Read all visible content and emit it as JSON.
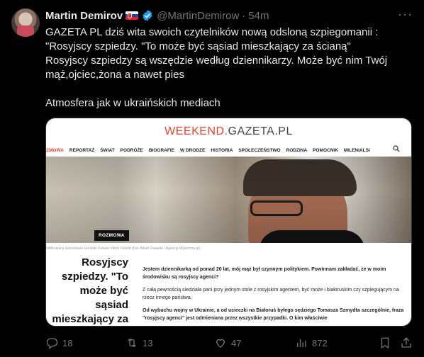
{
  "tweet": {
    "author_name": "Martin Demirov",
    "handle": "@MartinDemirow",
    "separator": "·",
    "time": "54m",
    "more_icon": "more-horizontal-icon",
    "text_lines": [
      "GAZETA PL dziś wita swoich czytelników nową odsloną szpiegomanii :",
      "\"Rosyjscy szpiedzy. \"To może być sąsiad mieszkający za ścianą\"",
      "Rosyjscy szpiedzy są wszędzie według dziennikarzy. Może być nim Twój",
      "mąż,ojciec,żona a nawet pies"
    ],
    "text_after_gap": "Atmosfera jak w ukraińskich mediach"
  },
  "card": {
    "logo_accent": "WEEKEND.",
    "logo_rest": "GAZETA.PL",
    "menu": [
      "ZMOWA",
      "REPORTAŻ",
      "ŚWIAT",
      "PODRÓŻE",
      "BIOGRAFIE",
      "W DRODZE",
      "HISTORIA",
      "SPOŁECZEŃSTWO",
      "RODZINA",
      "POMOCNIK",
      "MILENIALSI"
    ],
    "badge": "ROZMOWA",
    "caption": "Infiltrowany dziennikarz Gerardo Donato Viktor Girardi (Fot. Albert Zawada / Agencja Wyborcza.pl)",
    "headline": "Rosyjscy szpiedzy. \"To może być sąsiad mieszkający za ścianą\"",
    "body": {
      "p1": "Jestem dziennikarką od ponad 20 lat, mój mąż był czynnym politykiem. Powinnam zakładać, że w moim środowisku są rosyjscy agenci?",
      "p2": "Z całą pewnością siedziała pani przy jednym stole z rosyjskim agentem, być może i białoruskim czy szpiegującym na rzecz innego państwa.",
      "p3": "Od wybuchu wojny w Ukrainie, a od ucieczki na Białoruś byłego sędziego Tomasza Szmydta szczególnie, fraza \"rosyjscy agenci\" jest odmieniana przez wszystkie przypadki. O kim właściwie"
    }
  },
  "actions": {
    "reply_count": "18",
    "retweet_count": "13",
    "like_count": "47",
    "views_count": "872"
  },
  "colors": {
    "background": "#000000",
    "text": "#e7e9ea",
    "muted": "#71767b",
    "verified": "#1d9bf0",
    "gazeta_red": "#e8452a"
  }
}
